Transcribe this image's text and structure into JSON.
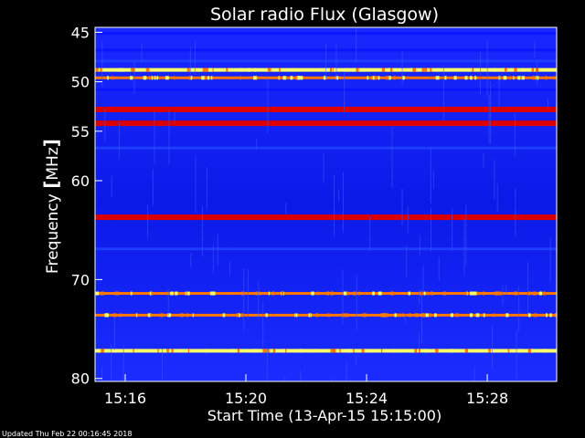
{
  "chart_data": {
    "type": "heatmap",
    "title": "Solar radio Flux (Glasgow)",
    "ylabel_parts": [
      "Frequency ",
      "[",
      "MHz",
      "]"
    ],
    "xlabel": "Start Time (13-Apr-15 15:15:00)",
    "footer": "Updated Thu Feb 22 00:16:45 2018",
    "x_range_minutes": [
      15.0,
      30.3
    ],
    "x_ticks": [
      {
        "label": "15:16",
        "minute": 16
      },
      {
        "label": "15:20",
        "minute": 20
      },
      {
        "label": "15:24",
        "minute": 24
      },
      {
        "label": "15:28",
        "minute": 28
      }
    ],
    "y_range_mhz": [
      44.5,
      80.3
    ],
    "y_ticks": [
      {
        "label": "45",
        "mhz": 45
      },
      {
        "label": "50",
        "mhz": 50
      },
      {
        "label": "55",
        "mhz": 55
      },
      {
        "label": "60",
        "mhz": 60
      },
      {
        "label": "70",
        "mhz": 70
      },
      {
        "label": "80",
        "mhz": 80
      }
    ],
    "colors": {
      "background": "#0000c8",
      "low": "#0a14ff",
      "mid": "#2040ff",
      "high": "#dd0000",
      "peak": "#ffff66",
      "orange": "#ff7700",
      "frame": "#ffffff"
    },
    "bands": [
      {
        "mhz": 45.1,
        "level": "low"
      },
      {
        "mhz": 46.8,
        "level": "low"
      },
      {
        "mhz": 47.9,
        "level": "mid"
      },
      {
        "mhz": 48.8,
        "level": "peak"
      },
      {
        "mhz": 49.6,
        "level": "orange"
      },
      {
        "mhz": 50.8,
        "level": "low"
      },
      {
        "mhz": 52.8,
        "level": "high"
      },
      {
        "mhz": 54.2,
        "level": "high"
      },
      {
        "mhz": 56.7,
        "level": "mid"
      },
      {
        "mhz": 63.7,
        "level": "high"
      },
      {
        "mhz": 66.9,
        "level": "mid"
      },
      {
        "mhz": 71.4,
        "level": "orange"
      },
      {
        "mhz": 73.6,
        "level": "orange"
      },
      {
        "mhz": 77.2,
        "level": "peak"
      }
    ]
  }
}
